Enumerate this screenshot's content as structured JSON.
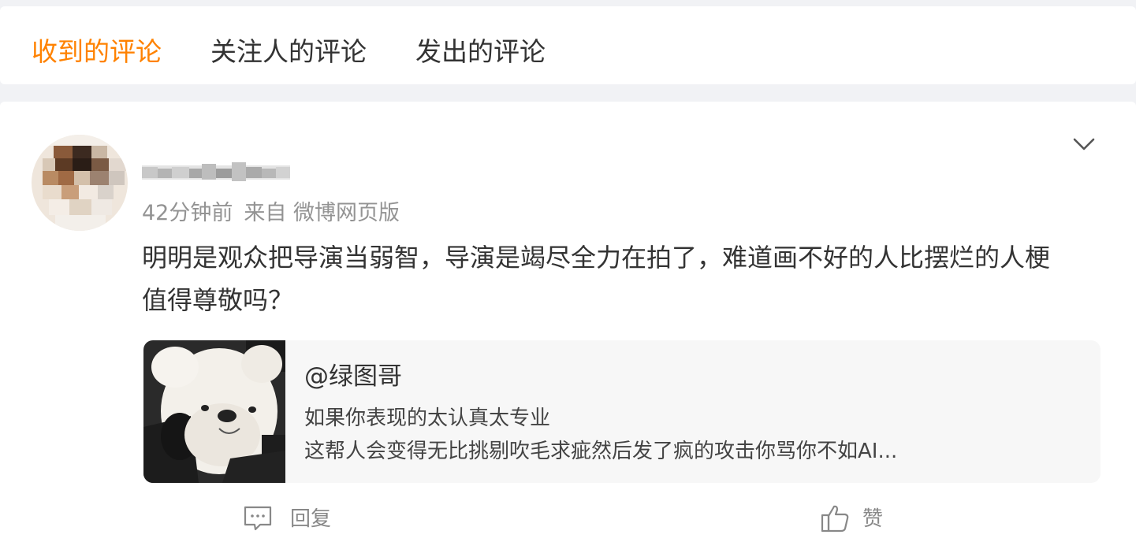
{
  "tabs": [
    {
      "label": "收到的评论",
      "active": true
    },
    {
      "label": "关注人的评论",
      "active": false
    },
    {
      "label": "发出的评论",
      "active": false
    }
  ],
  "comment": {
    "time": "42分钟前",
    "source": "来自 微博网页版",
    "text": "明明是观众把导演当弱智，导演是竭尽全力在拍了，难道画不好的人比摆烂的人梗值得尊敬吗？",
    "quoted": {
      "author": "@绿图哥",
      "line1": "如果你表现的太认真太专业",
      "line2": "这帮人会变得无比挑剔吹毛求疵然后发了疯的攻击你骂你不如AI..."
    },
    "actions": {
      "reply_label": "回复",
      "like_label": "赞"
    }
  },
  "icons": {
    "expand": "chevron-down-icon",
    "reply": "comment-bubble-icon",
    "like": "thumbs-up-icon"
  },
  "colors": {
    "accent": "#ff8200",
    "text": "#333333",
    "muted": "#939393",
    "background": "#f1f2f5",
    "quote_bg": "#f7f7f7"
  }
}
